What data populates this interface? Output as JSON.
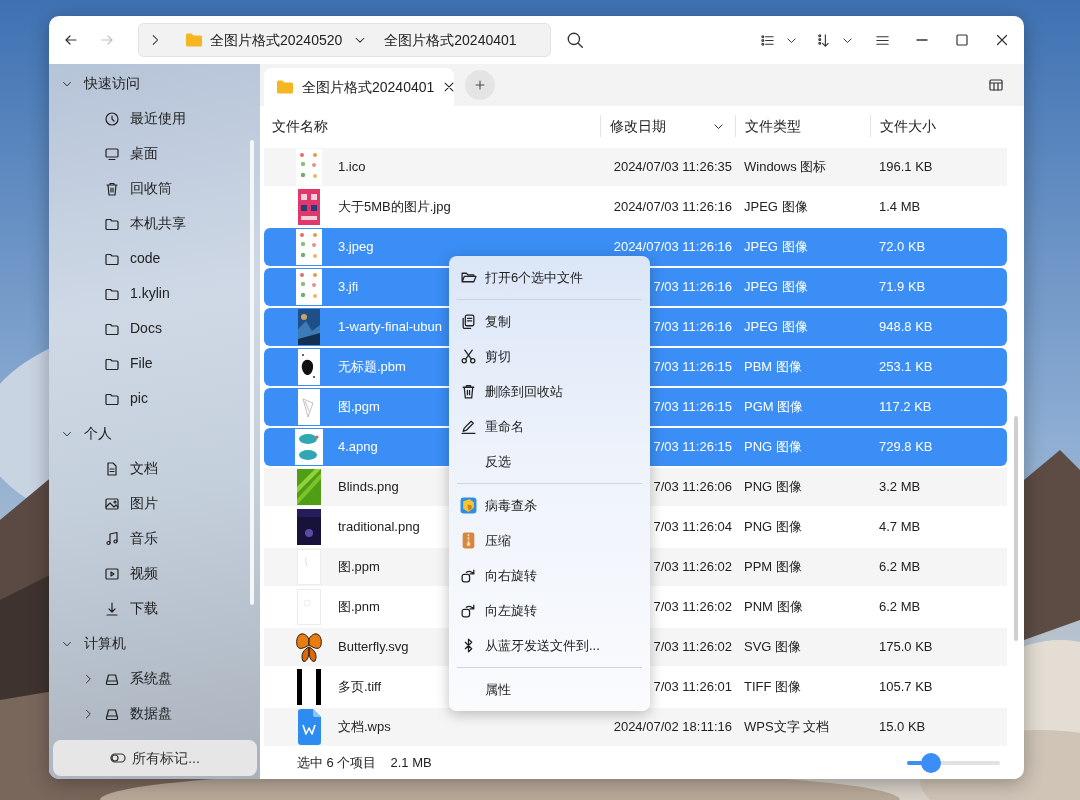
{
  "navigation": [
    {
      "kind": "back",
      "disabled": false
    },
    {
      "kind": "forward",
      "disabled": true
    }
  ],
  "breadcrumb": [
    {
      "label": "全图片格式20240520"
    },
    {
      "label": "全图片格式20240401"
    }
  ],
  "tabs": [
    {
      "label": "全图片格式20240401",
      "selected": true
    }
  ],
  "sidebar": {
    "sections": [
      {
        "label": "快速访问",
        "expanded": true,
        "children": [
          {
            "label": "最近使用",
            "kind": "recent"
          },
          {
            "label": "桌面",
            "kind": "desktop"
          },
          {
            "label": "回收筒",
            "kind": "trash"
          },
          {
            "label": "本机共享",
            "kind": "folder"
          },
          {
            "label": "code",
            "kind": "folder"
          },
          {
            "label": "1.kylin",
            "kind": "folder"
          },
          {
            "label": "Docs",
            "kind": "folder"
          },
          {
            "label": "File",
            "kind": "folder"
          },
          {
            "label": "pic",
            "kind": "folder"
          }
        ]
      },
      {
        "label": "个人",
        "expanded": true,
        "children": [
          {
            "label": "文档",
            "kind": "document"
          },
          {
            "label": "图片",
            "kind": "pictures"
          },
          {
            "label": "音乐",
            "kind": "music"
          },
          {
            "label": "视频",
            "kind": "videos"
          },
          {
            "label": "下载",
            "kind": "downloads"
          }
        ]
      },
      {
        "label": "计算机",
        "expanded": true,
        "children": [
          {
            "label": "系统盘",
            "kind": "drive",
            "expanded": false
          },
          {
            "label": "数据盘",
            "kind": "drive",
            "expanded": false
          }
        ]
      }
    ],
    "footer_button": "所有标记..."
  },
  "table": {
    "columns": [
      {
        "label": "文件名称",
        "sorted": false
      },
      {
        "label": "修改日期",
        "sorted": true
      },
      {
        "label": "文件类型",
        "sorted": false
      },
      {
        "label": "文件大小",
        "sorted": false
      }
    ],
    "rows": [
      {
        "name": "1.ico",
        "modified": "2024/07/03 11:26:35",
        "type": "Windows 图标",
        "size": "196.1 KB",
        "kind": "picture",
        "selected": false
      },
      {
        "name": "大于5MB的图片.jpg",
        "modified": "2024/07/03 11:26:16",
        "type": "JPEG 图像",
        "size": "1.4 MB",
        "kind": "picture",
        "selected": false
      },
      {
        "name": "3.jpeg",
        "modified": "2024/07/03 11:26:16",
        "type": "JPEG 图像",
        "size": "72.0 KB",
        "kind": "picture",
        "selected": true
      },
      {
        "name": "3.jfi",
        "modified": "7/03 11:26:16",
        "type": "JPEG 图像",
        "size": "71.9 KB",
        "kind": "picture",
        "selected": true
      },
      {
        "name": "1-warty-final-ubun",
        "modified": "7/03 11:26:16",
        "type": "JPEG 图像",
        "size": "948.8 KB",
        "kind": "picture",
        "selected": true
      },
      {
        "name": "无标题.pbm",
        "modified": "7/03 11:26:15",
        "type": "PBM 图像",
        "size": "253.1 KB",
        "kind": "picture",
        "selected": true
      },
      {
        "name": "图.pgm",
        "modified": "7/03 11:26:15",
        "type": "PGM 图像",
        "size": "117.2 KB",
        "kind": "picture",
        "selected": true
      },
      {
        "name": "4.apng",
        "modified": "7/03 11:26:15",
        "type": "PNG 图像",
        "size": "729.8 KB",
        "kind": "picture",
        "selected": true
      },
      {
        "name": "Blinds.png",
        "modified": "7/03 11:26:06",
        "type": "PNG 图像",
        "size": "3.2 MB",
        "kind": "picture",
        "selected": false
      },
      {
        "name": "traditional.png",
        "modified": "7/03 11:26:04",
        "type": "PNG 图像",
        "size": "4.7 MB",
        "kind": "picture",
        "selected": false
      },
      {
        "name": "图.ppm",
        "modified": "7/03 11:26:02",
        "type": "PPM 图像",
        "size": "6.2 MB",
        "kind": "picture",
        "selected": false
      },
      {
        "name": "图.pnm",
        "modified": "7/03 11:26:02",
        "type": "PNM 图像",
        "size": "6.2 MB",
        "kind": "picture",
        "selected": false
      },
      {
        "name": "Butterfly.svg",
        "modified": "7/03 11:26:02",
        "type": "SVG 图像",
        "size": "175.0 KB",
        "kind": "picture",
        "selected": false
      },
      {
        "name": "多页.tiff",
        "modified": "7/03 11:26:01",
        "type": "TIFF 图像",
        "size": "105.7 KB",
        "kind": "picture",
        "selected": false
      },
      {
        "name": "文档.wps",
        "modified": "2024/07/02 18:11:16",
        "type": "WPS文字 文档",
        "size": "15.0 KB",
        "kind": "document",
        "selected": false
      }
    ]
  },
  "context_menu": {
    "items": [
      {
        "kind": "open",
        "label": "打开6个选中文件"
      },
      {
        "kind": "separator"
      },
      {
        "kind": "copy",
        "label": "复制"
      },
      {
        "kind": "cut",
        "label": "剪切"
      },
      {
        "kind": "delete",
        "label": "删除到回收站"
      },
      {
        "kind": "rename",
        "label": "重命名"
      },
      {
        "kind": "plain",
        "label": "反选"
      },
      {
        "kind": "separator"
      },
      {
        "kind": "scan",
        "label": "病毒查杀"
      },
      {
        "kind": "compress",
        "label": "压缩"
      },
      {
        "kind": "clockwise",
        "label": "向右旋转"
      },
      {
        "kind": "counterclockwise",
        "label": "向左旋转"
      },
      {
        "kind": "bluetooth",
        "label": "从蓝牙发送文件到..."
      },
      {
        "kind": "separator"
      },
      {
        "kind": "plain",
        "label": "属性"
      }
    ]
  },
  "status_bar": {
    "selection": "选中 6 个项目",
    "size": "2.1 MB",
    "zoom": {
      "level": 0.26
    }
  }
}
